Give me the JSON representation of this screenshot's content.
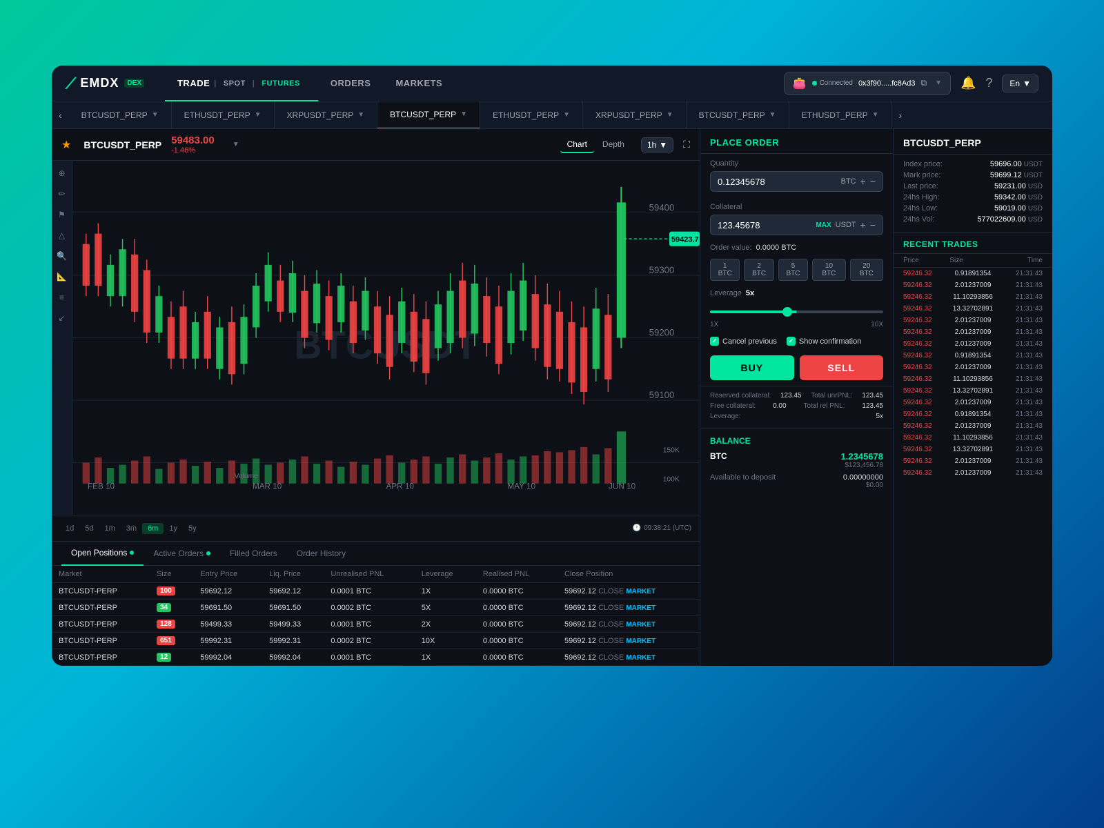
{
  "logo": {
    "text": "EMDX",
    "dex": "DEX"
  },
  "nav": {
    "links": [
      {
        "id": "trade",
        "label": "TRADE",
        "active": true
      },
      {
        "id": "orders",
        "label": "ORDERS",
        "active": false
      },
      {
        "id": "markets",
        "label": "MARKETS",
        "active": false
      }
    ],
    "sublinks": [
      {
        "id": "spot",
        "label": "SPOT",
        "active": false
      },
      {
        "id": "futures",
        "label": "FUTURES",
        "active": true
      }
    ],
    "wallet": {
      "connected_label": "Connected",
      "address": "0x3f90.....fc8Ad3",
      "lang": "En"
    }
  },
  "ticker_pairs": [
    {
      "label": "BTCUSDT_PERP",
      "active": false
    },
    {
      "label": "ETHUSDT_PERP",
      "active": false
    },
    {
      "label": "XRPUSDT_PERP",
      "active": false
    },
    {
      "label": "BTCUSDT_PERP",
      "active": true
    },
    {
      "label": "ETHUSDT_PERP",
      "active": false
    },
    {
      "label": "XRPUSDT_PERP",
      "active": false
    },
    {
      "label": "BTCUSDT_PERP",
      "active": false
    },
    {
      "label": "ETHUSDT_PERP",
      "active": false
    }
  ],
  "chart": {
    "symbol": "BTCUSDT_PERP",
    "price": "59483.00",
    "change": "-1.46%",
    "tabs": [
      "Chart",
      "Depth"
    ],
    "active_tab": "Chart",
    "timeframe": "1h",
    "timeframes": [
      "1d",
      "5d",
      "1m",
      "3m",
      "6m",
      "1y",
      "5y"
    ],
    "active_tf": "6m",
    "timestamp": "09:38:21 (UTC)",
    "watermark": "BTCUSDT"
  },
  "order_panel": {
    "title": "PLACE ORDER",
    "quantity_label": "Quantity",
    "quantity_value": "0.12345678",
    "quantity_currency": "BTC",
    "collateral_label": "Collateral",
    "collateral_value": "123.45678",
    "collateral_currency": "USDT",
    "max_label": "MAX",
    "order_value_label": "Order value:",
    "order_value": "0.0000 BTC",
    "btc_presets": [
      "1 BTC",
      "2 BTC",
      "5 BTC",
      "10 BTC",
      "20 BTC"
    ],
    "leverage_label": "Leverage",
    "leverage_value": "5x",
    "leverage_min": "1X",
    "leverage_max": "10X",
    "cancel_prev_label": "Cancel previous",
    "show_confirm_label": "Show confirmation",
    "buy_label": "BUY",
    "sell_label": "SELL",
    "reserved_collateral_label": "Reserved collateral:",
    "reserved_collateral_value": "123.45",
    "total_unrpnl_label": "Total unrPNL:",
    "total_unrpnl_value": "123.45",
    "free_collateral_label": "Free collateral:",
    "free_collateral_value": "0.00",
    "total_rel_pnl_label": "Total rel PNL:",
    "total_rel_pnl_value": "123.45",
    "leverage_info_label": "Leverage:",
    "leverage_info_value": "5x",
    "balance_title": "BALANCE",
    "balance_currency": "BTC",
    "balance_main_before": "1.234",
    "balance_main_after": "5678",
    "balance_usd": "$123,456.78",
    "available_label": "Available to deposit",
    "available_value": "0.00000000",
    "available_usd": "$0.00"
  },
  "info_panel": {
    "symbol": "BTCUSDT_PERP",
    "prices": [
      {
        "label": "Index price:",
        "value": "59696.00",
        "currency": "USDT"
      },
      {
        "label": "Mark price:",
        "value": "59699.12",
        "currency": "USDT"
      },
      {
        "label": "Last price:",
        "value": "59231.00",
        "currency": "USD"
      },
      {
        "label": "24hs High:",
        "value": "59342.00",
        "currency": "USD"
      },
      {
        "label": "24hs Low:",
        "value": "59019.00",
        "currency": "USD"
      },
      {
        "label": "24hs Vol:",
        "value": "577022609.00",
        "currency": "USD"
      }
    ],
    "recent_trades_title": "RECENT TRADES",
    "trades_cols": [
      "Price",
      "Size",
      "Time"
    ],
    "trades": [
      {
        "price": "59246.32",
        "size": "0.91891354",
        "time": "21:31:43"
      },
      {
        "price": "59246.32",
        "size": "2.01237009",
        "time": "21:31:43"
      },
      {
        "price": "59246.32",
        "size": "11.10293856",
        "time": "21:31:43"
      },
      {
        "price": "59246.32",
        "size": "13.32702891",
        "time": "21:31:43"
      },
      {
        "price": "59246.32",
        "size": "2.01237009",
        "time": "21:31:43"
      },
      {
        "price": "59246.32",
        "size": "2.01237009",
        "time": "21:31:43"
      },
      {
        "price": "59246.32",
        "size": "2.01237009",
        "time": "21:31:43"
      },
      {
        "price": "59246.32",
        "size": "0.91891354",
        "time": "21:31:43"
      },
      {
        "price": "59246.32",
        "size": "2.01237009",
        "time": "21:31:43"
      },
      {
        "price": "59246.32",
        "size": "11.10293856",
        "time": "21:31:43"
      },
      {
        "price": "59246.32",
        "size": "13.32702891",
        "time": "21:31:43"
      },
      {
        "price": "59246.32",
        "size": "2.01237009",
        "time": "21:31:43"
      },
      {
        "price": "59246.32",
        "size": "0.91891354",
        "time": "21:31:43"
      },
      {
        "price": "59246.32",
        "size": "2.01237009",
        "time": "21:31:43"
      },
      {
        "price": "59246.32",
        "size": "11.10293856",
        "time": "21:31:43"
      },
      {
        "price": "59246.32",
        "size": "13.32702891",
        "time": "21:31:43"
      },
      {
        "price": "59246.32",
        "size": "2.01237009",
        "time": "21:31:43"
      },
      {
        "price": "59246.32",
        "size": "2.01237009",
        "time": "21:31:43"
      }
    ]
  },
  "bottom_tabs": [
    {
      "id": "open-positions",
      "label": "Open Positions",
      "dot": true,
      "active": true
    },
    {
      "id": "active-orders",
      "label": "Active Orders",
      "dot": true,
      "active": false
    },
    {
      "id": "filled-orders",
      "label": "Filled Orders",
      "dot": false,
      "active": false
    },
    {
      "id": "order-history",
      "label": "Order History",
      "dot": false,
      "active": false
    }
  ],
  "orders_table": {
    "headers": [
      "Market",
      "Size",
      "Entry Price",
      "Liq. Price",
      "Unrealised PNL",
      "Leverage",
      "Realised PNL",
      "Close Position"
    ],
    "rows": [
      {
        "market": "BTCUSDT-PERP",
        "size": "100",
        "size_type": "red",
        "entry": "59692.12",
        "liq": "59692.12",
        "liq_color": "yellow",
        "unrealised": "0.0001 BTC",
        "leverage": "1X",
        "realised": "0.0000 BTC",
        "close_price": "59692.12",
        "close": "CLOSE",
        "market_label": "MARKET"
      },
      {
        "market": "BTCUSDT-PERP",
        "size": "34",
        "size_type": "green",
        "entry": "59691.50",
        "liq": "59691.50",
        "liq_color": "yellow",
        "unrealised": "0.0002 BTC",
        "leverage": "5X",
        "realised": "0.0000 BTC",
        "close_price": "59692.12",
        "close": "CLOSE",
        "market_label": "MARKET"
      },
      {
        "market": "BTCUSDT-PERP",
        "size": "128",
        "size_type": "red",
        "entry": "59499.33",
        "liq": "59499.33",
        "liq_color": "yellow",
        "unrealised": "0.0001 BTC",
        "leverage": "2X",
        "realised": "0.0000 BTC",
        "close_price": "59692.12",
        "close": "CLOSE",
        "market_label": "MARKET"
      },
      {
        "market": "BTCUSDT-PERP",
        "size": "651",
        "size_type": "red",
        "entry": "59992.31",
        "liq": "59992.31",
        "liq_color": "yellow",
        "unrealised": "0.0002 BTC",
        "leverage": "10X",
        "realised": "0.0000 BTC",
        "close_price": "59692.12",
        "close": "CLOSE",
        "market_label": "MARKET"
      },
      {
        "market": "BTCUSDT-PERP",
        "size": "12",
        "size_type": "green",
        "entry": "59992.04",
        "liq": "59992.04",
        "liq_color": "yellow",
        "unrealised": "0.0001 BTC",
        "leverage": "1X",
        "realised": "0.0000 BTC",
        "close_price": "59692.12",
        "close": "CLOSE",
        "market_label": "MARKET"
      }
    ]
  }
}
